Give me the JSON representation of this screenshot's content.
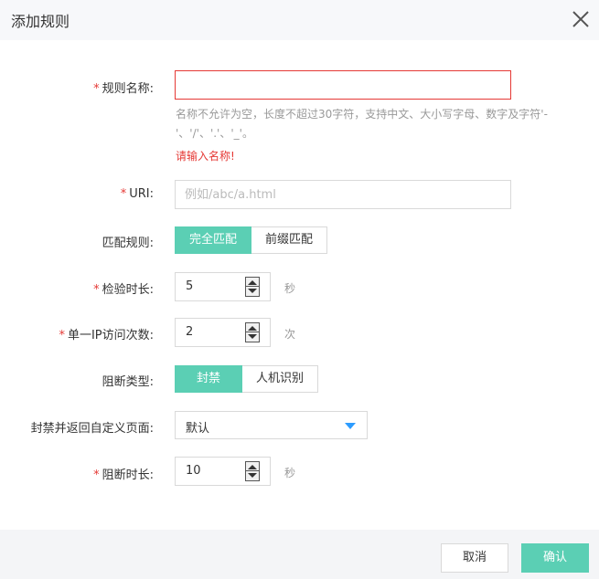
{
  "dialog": {
    "title": "添加规则",
    "close_icon": "close-icon"
  },
  "form": {
    "required_mark": "*",
    "rule_name": {
      "label": "规则名称:",
      "value": "",
      "hint": "名称不允许为空，长度不超过30字符，支持中文、大小写字母、数字及字符'-'、'/'、'.'、'_'。",
      "error": "请输入名称!"
    },
    "uri": {
      "label": "URI:",
      "value": "",
      "placeholder": "例如/abc/a.html"
    },
    "match_rule": {
      "label": "匹配规则:",
      "options": [
        "完全匹配",
        "前缀匹配"
      ],
      "selected": "完全匹配"
    },
    "check_duration": {
      "label": "检验时长:",
      "value": "5",
      "unit": "秒"
    },
    "single_ip_visits": {
      "label": "单一IP访问次数:",
      "value": "2",
      "unit": "次"
    },
    "block_type": {
      "label": "阻断类型:",
      "options": [
        "封禁",
        "人机识别"
      ],
      "selected": "封禁"
    },
    "custom_page": {
      "label": "封禁并返回自定义页面:",
      "value": "默认"
    },
    "block_duration": {
      "label": "阻断时长:",
      "value": "10",
      "unit": "秒"
    }
  },
  "footer": {
    "cancel_label": "取消",
    "confirm_label": "确认"
  },
  "colors": {
    "accent": "#5bcfb4",
    "error": "#e53935",
    "caret": "#2d9cff"
  }
}
